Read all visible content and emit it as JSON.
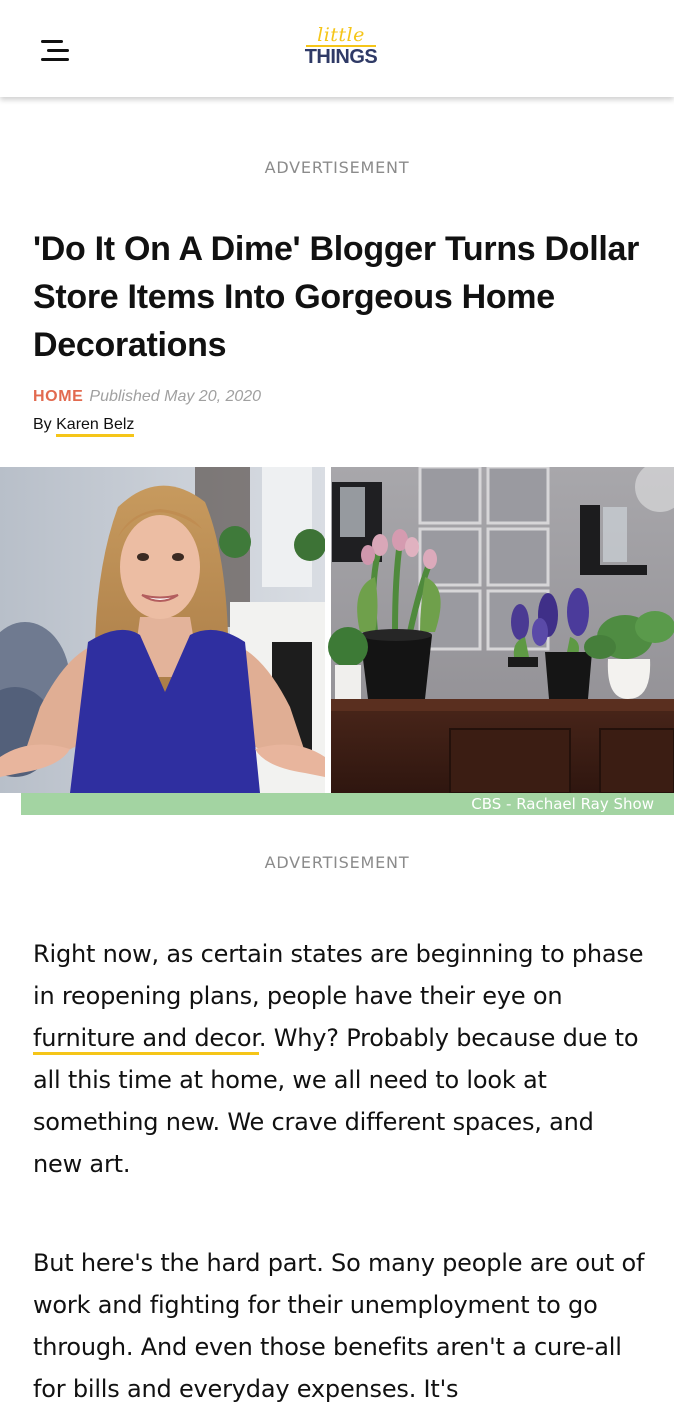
{
  "header": {
    "menu_icon": "hamburger-menu-icon",
    "logo": {
      "top": "little",
      "bottom": "THINGS"
    }
  },
  "ads": {
    "label_top": "ADVERTISEMENT",
    "label_bottom": "ADVERTISEMENT"
  },
  "article": {
    "title": "'Do It On A Dime' Blogger Turns Dollar Store Items Into Gorgeous Home Decorations",
    "category": "HOME",
    "published": "Published May 20, 2020",
    "by_prefix": "By",
    "author": "Karen Belz",
    "image_caption": "CBS - Rachael Ray Show",
    "paragraph1": {
      "before_link": "Right now, as certain states are beginning to phase in reopening plans, people have their eye on ",
      "link": "furniture and decor",
      "after_link": ". Why? Probably because due to all this time at home, we all need to look at something new. We crave different spaces, and new art."
    },
    "paragraph2": "But here's the hard part. So many people are out of work and fighting for their unemployment to go through. And even those benefits aren't a cure-all for bills and everyday expenses. It's"
  },
  "colors": {
    "accent_yellow": "#f5c518",
    "logo_navy": "#2f3a66",
    "category_coral": "#e26a4f",
    "caption_green": "#a3d4a2"
  }
}
